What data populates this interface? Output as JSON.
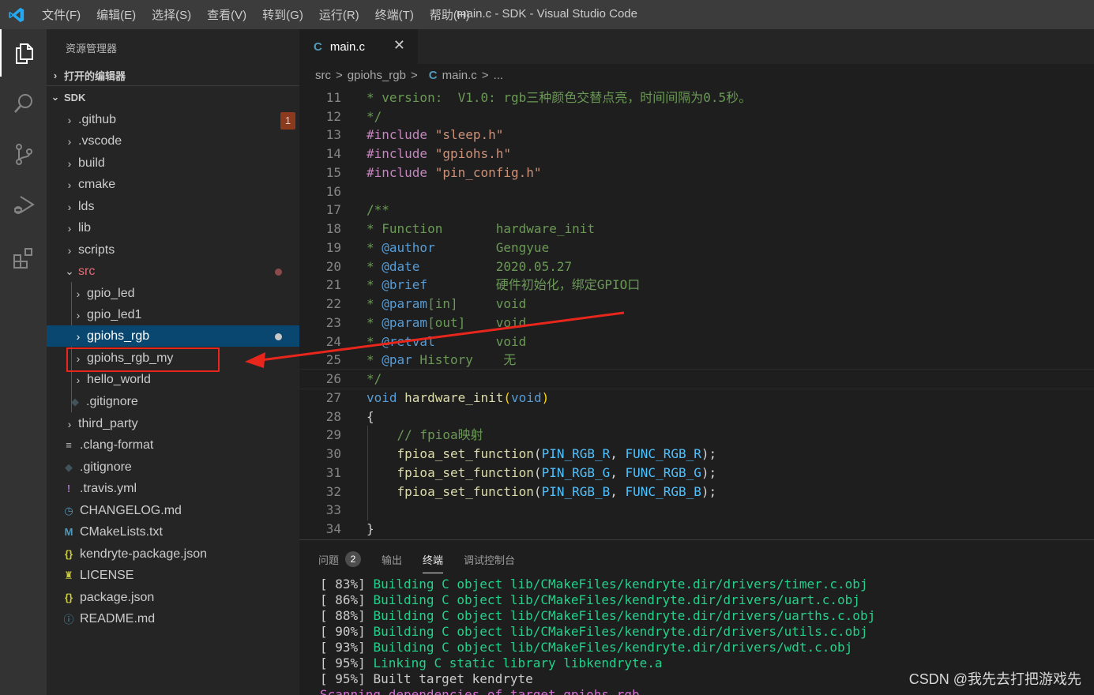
{
  "titlebar": {
    "menu": [
      "文件(F)",
      "编辑(E)",
      "选择(S)",
      "查看(V)",
      "转到(G)",
      "运行(R)",
      "终端(T)",
      "帮助(H)"
    ],
    "window_title": "main.c - SDK - Visual Studio Code"
  },
  "activitybar": {
    "items": [
      "explorer-icon",
      "search-icon",
      "source-control-icon",
      "run-debug-icon",
      "extensions-icon"
    ]
  },
  "sidebar": {
    "title": "资源管理器",
    "open_editors_label": "打开的编辑器",
    "workspace_label": "SDK",
    "tree": [
      {
        "label": ".github",
        "type": "folder",
        "badge": "1"
      },
      {
        "label": ".vscode",
        "type": "folder"
      },
      {
        "label": "build",
        "type": "folder"
      },
      {
        "label": "cmake",
        "type": "folder"
      },
      {
        "label": "lds",
        "type": "folder"
      },
      {
        "label": "lib",
        "type": "folder"
      },
      {
        "label": "scripts",
        "type": "folder"
      },
      {
        "label": "src",
        "type": "folder-open"
      },
      {
        "label": "gpio_led",
        "type": "folder"
      },
      {
        "label": "gpio_led1",
        "type": "folder"
      },
      {
        "label": "gpiohs_rgb",
        "type": "folder"
      },
      {
        "label": "gpiohs_rgb_my",
        "type": "folder"
      },
      {
        "label": "hello_world",
        "type": "folder"
      },
      {
        "label": ".gitignore",
        "type": "file"
      },
      {
        "label": "third_party",
        "type": "folder"
      },
      {
        "label": ".clang-format",
        "type": "file"
      },
      {
        "label": ".gitignore",
        "type": "file"
      },
      {
        "label": ".travis.yml",
        "type": "file"
      },
      {
        "label": "CHANGELOG.md",
        "type": "file"
      },
      {
        "label": "CMakeLists.txt",
        "type": "file"
      },
      {
        "label": "kendryte-package.json",
        "type": "file"
      },
      {
        "label": "LICENSE",
        "type": "file"
      },
      {
        "label": "package.json",
        "type": "file"
      },
      {
        "label": "README.md",
        "type": "file"
      }
    ]
  },
  "editor": {
    "tab_label": "main.c",
    "tab_close": "✕",
    "breadcrumb": [
      "src",
      ">",
      "gpiohs_rgb",
      ">",
      "C",
      "main.c",
      ">",
      "..."
    ],
    "line_numbers": [
      "11",
      "12",
      "13",
      "14",
      "15",
      "16",
      "17",
      "18",
      "19",
      "20",
      "21",
      "22",
      "23",
      "24",
      "25",
      "26",
      "27",
      "28",
      "29",
      "30",
      "31",
      "32",
      "33",
      "34"
    ]
  },
  "panel": {
    "tabs": [
      "问题",
      "输出",
      "终端",
      "调试控制台"
    ],
    "problems_count": "2",
    "terminal_lines": [
      {
        "pct": "[ 83%] ",
        "text": "Building C object lib/CMakeFiles/kendryte.dir/drivers/timer.c.obj"
      },
      {
        "pct": "[ 86%] ",
        "text": "Building C object lib/CMakeFiles/kendryte.dir/drivers/uart.c.obj"
      },
      {
        "pct": "[ 88%] ",
        "text": "Building C object lib/CMakeFiles/kendryte.dir/drivers/uarths.c.obj"
      },
      {
        "pct": "[ 90%] ",
        "text": "Building C object lib/CMakeFiles/kendryte.dir/drivers/utils.c.obj"
      },
      {
        "pct": "[ 93%] ",
        "text": "Building C object lib/CMakeFiles/kendryte.dir/drivers/wdt.c.obj"
      },
      {
        "pct": "[ 95%] ",
        "text": "Linking C static library libkendryte.a"
      },
      {
        "pct": "[ 95%] ",
        "text": "Built target kendryte"
      },
      {
        "pct": "",
        "text": "Scanning dependencies of target gpiohs_rgb"
      }
    ]
  },
  "watermark": "CSDN @我先去打把游戏先",
  "colors": {
    "annotation_red": "#e8261c",
    "selection_blue": "#094771",
    "terminal_green": "#23d18b"
  }
}
